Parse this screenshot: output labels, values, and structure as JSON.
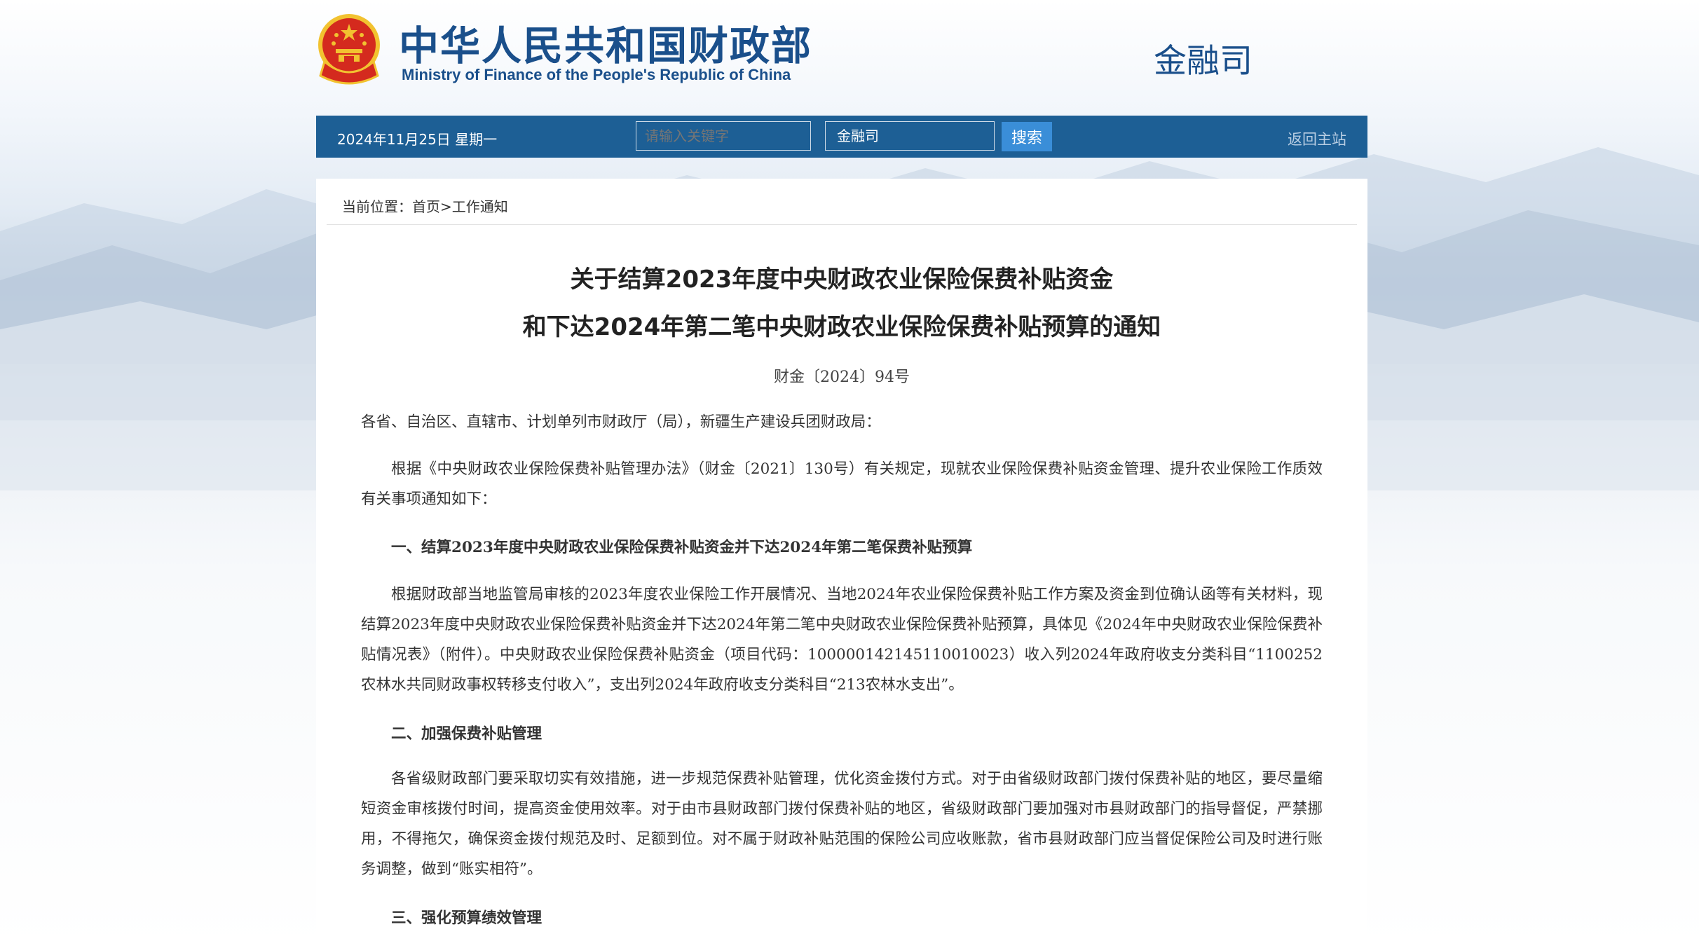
{
  "header": {
    "site_name_cn": "中华人民共和国财政部",
    "site_name_en": "Ministry of Finance of the People's Republic of China",
    "department": "金融司"
  },
  "navbar": {
    "date": "2024年11月25日 星期一",
    "keyword_placeholder": "请输入关键字",
    "department_select": "金融司",
    "search_label": "搜索",
    "home_link": "返回主站"
  },
  "breadcrumb": {
    "prefix": "当前位置：",
    "home": "首页",
    "separator": ">",
    "section": "工作通知"
  },
  "article": {
    "title_line1": "关于结算2023年度中央财政农业保险保费补贴资金",
    "title_line2": "和下达2024年第二笔中央财政农业保险保费补贴预算的通知",
    "doc_number": "财金〔2024〕94号",
    "salutation": "各省、自治区、直辖市、计划单列市财政厅（局），新疆生产建设兵团财政局：",
    "intro": "根据《中央财政农业保险保费补贴管理办法》（财金〔2021〕130号）有关规定，现就农业保险保费补贴资金管理、提升农业保险工作质效有关事项通知如下：",
    "heading1": "一、结算2023年度中央财政农业保险保费补贴资金并下达2024年第二笔保费补贴预算",
    "para1": "根据财政部当地监管局审核的2023年度农业保险工作开展情况、当地2024年农业保险保费补贴工作方案及资金到位确认函等有关材料，现结算2023年度中央财政农业保险保费补贴资金并下达2024年第二笔中央财政农业保险保费补贴预算，具体见《2024年中央财政农业保险保费补贴情况表》（附件）。中央财政农业保险保费补贴资金（项目代码：100000142145110010023）收入列2024年政府收支分类科目“1100252农林水共同财政事权转移支付收入”，支出列2024年政府收支分类科目“213农林水支出”。",
    "heading2": "二、加强保费补贴管理",
    "para2": "各省级财政部门要采取切实有效措施，进一步规范保费补贴管理，优化资金拨付方式。对于由省级财政部门拨付保费补贴的地区，要尽量缩短资金审核拨付时间，提高资金使用效率。对于由市县财政部门拨付保费补贴的地区，省级财政部门要加强对市县财政部门的指导督促，严禁挪用，不得拖欠，确保资金拨付规范及时、足额到位。对不属于财政补贴范围的保险公司应收账款，省市县财政部门应当督促保险公司及时进行账务调整，做到“账实相符”。",
    "heading3": "三、强化预算绩效管理"
  },
  "colors": {
    "brand_blue": "#1a4f8b",
    "nav_bar": "#1d5f95",
    "search_button": "#3a8ed8",
    "emblem_red": "#d42a1e",
    "emblem_gold": "#f2c230"
  }
}
